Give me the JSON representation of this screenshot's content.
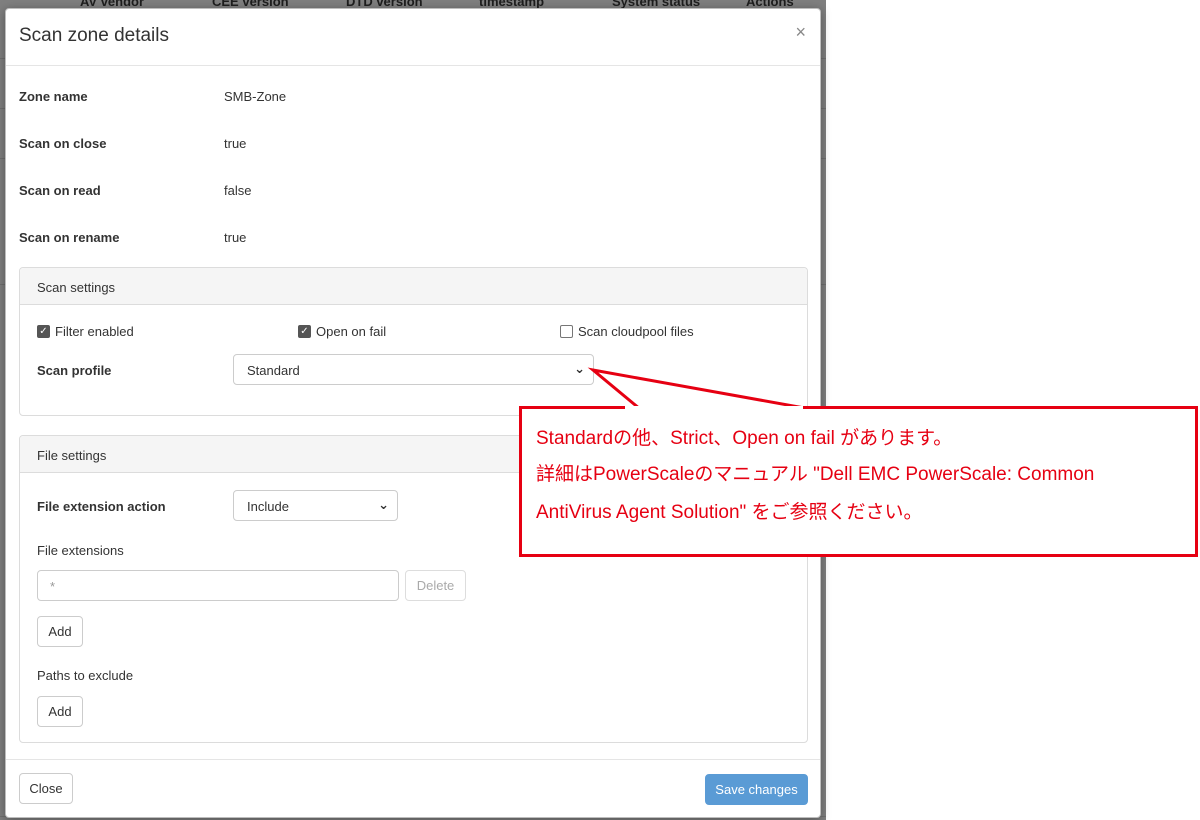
{
  "background": {
    "columns": [
      "AV vendor",
      "CEE version",
      "DTD version",
      "timestamp",
      "System status",
      "Actions"
    ]
  },
  "modal": {
    "title": "Scan zone details",
    "close_icon": "×",
    "fields": [
      {
        "label": "Zone name",
        "value": "SMB-Zone"
      },
      {
        "label": "Scan on close",
        "value": "true"
      },
      {
        "label": "Scan on read",
        "value": "false"
      },
      {
        "label": "Scan on rename",
        "value": "true"
      }
    ],
    "scan_settings": {
      "heading": "Scan settings",
      "filter_enabled": {
        "label": "Filter enabled",
        "checked": true
      },
      "open_on_fail": {
        "label": "Open on fail",
        "checked": true
      },
      "scan_cloudpool": {
        "label": "Scan cloudpool files",
        "checked": false
      },
      "profile_label": "Scan profile",
      "profile_value": "Standard"
    },
    "file_settings": {
      "heading": "File settings",
      "action_label": "File extension action",
      "action_value": "Include",
      "extensions_label": "File extensions",
      "extension_value": "*",
      "delete_label": "Delete",
      "add_label": "Add",
      "paths_label": "Paths to exclude",
      "paths_add_label": "Add"
    },
    "footer": {
      "close_label": "Close",
      "save_label": "Save changes"
    }
  },
  "callout": {
    "line1": "Standardの他、Strict、Open on fail があります。",
    "line2": "詳細はPowerScaleのマニュアル \"Dell EMC PowerScale: Common",
    "line3": "AntiVirus Agent Solution\" をご参照ください。"
  },
  "colors": {
    "callout_red": "#e60012",
    "primary_button": "#5a9bd5",
    "backdrop": "#7f7f7f"
  }
}
